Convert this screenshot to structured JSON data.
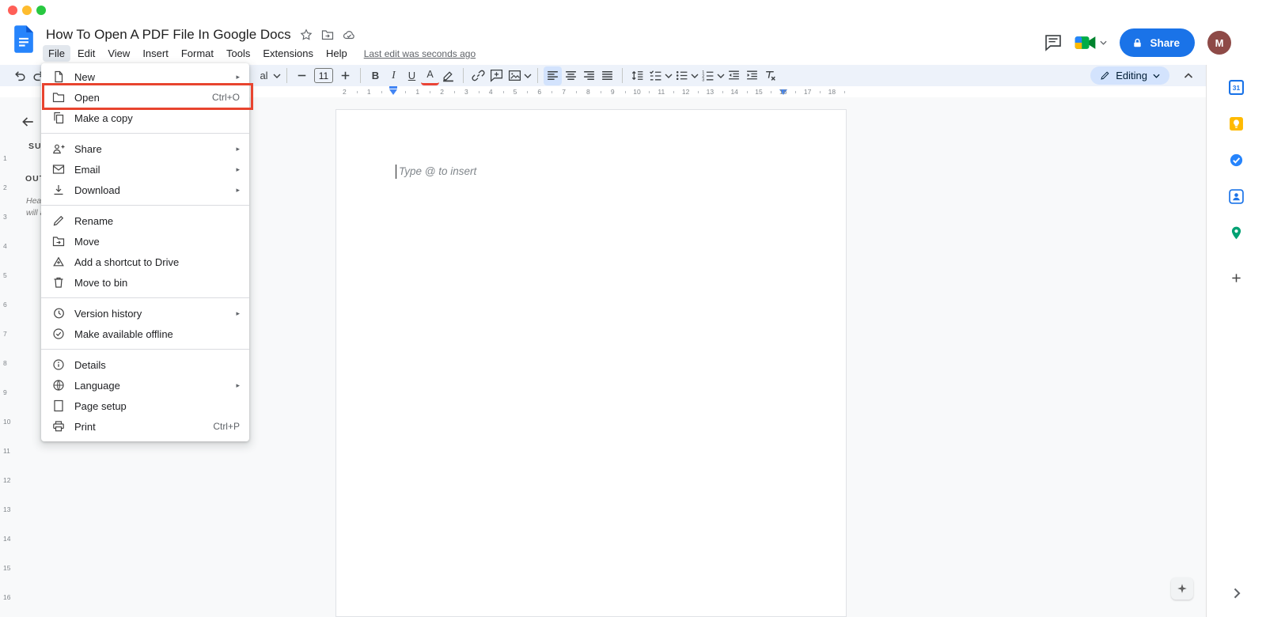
{
  "colors": {
    "accent_blue": "#1a73e8",
    "toolbar_bg": "#edf2fa",
    "editing_chip_bg": "#d3e3fd",
    "highlight_red": "#e8442f",
    "canvas_bg": "#f8f9fa",
    "text_color_underline": "#ea4335",
    "traffic_lights": [
      "#ff5f57",
      "#febc2e",
      "#28c840"
    ]
  },
  "header": {
    "title": "How To Open A PDF File In Google Docs",
    "menu_items": [
      {
        "label": "File",
        "active": true
      },
      {
        "label": "Edit"
      },
      {
        "label": "View"
      },
      {
        "label": "Insert"
      },
      {
        "label": "Format"
      },
      {
        "label": "Tools"
      },
      {
        "label": "Extensions"
      },
      {
        "label": "Help"
      }
    ],
    "last_edit": "Last edit was seconds ago",
    "share_label": "Share",
    "avatar_letter": "M"
  },
  "toolbar": {
    "editing_label": "Editing",
    "items": [
      {
        "name": "undo",
        "icon": "undo-icon"
      },
      {
        "name": "redo",
        "icon": "redo-icon"
      },
      {
        "type": "spacer"
      },
      {
        "name": "font-family-partial",
        "type": "text",
        "text": "al",
        "caret": true
      },
      {
        "type": "sep"
      },
      {
        "name": "decrease-font-size",
        "icon": "minus-icon"
      },
      {
        "name": "font-size",
        "type": "box",
        "text": "11"
      },
      {
        "name": "increase-font-size",
        "icon": "plus-icon"
      },
      {
        "type": "sep"
      },
      {
        "name": "bold",
        "type": "text",
        "text": "B",
        "style": "sb"
      },
      {
        "name": "italic",
        "type": "text",
        "text": "I",
        "style": "si"
      },
      {
        "name": "underline",
        "type": "text",
        "text": "U",
        "style": "su"
      },
      {
        "name": "text-color",
        "type": "text",
        "text": "A",
        "style": "sa"
      },
      {
        "name": "highlight-color",
        "icon": "highlighter-icon"
      },
      {
        "type": "sep"
      },
      {
        "name": "insert-link",
        "icon": "link-icon"
      },
      {
        "name": "add-comment",
        "icon": "comment-add-icon"
      },
      {
        "name": "insert-image",
        "icon": "image-icon",
        "caret": true
      },
      {
        "type": "sep"
      },
      {
        "name": "align-left",
        "icon": "align-left-icon",
        "active": true
      },
      {
        "name": "align-center",
        "icon": "align-center-icon"
      },
      {
        "name": "align-right",
        "icon": "align-right-icon"
      },
      {
        "name": "align-justify",
        "icon": "align-justify-icon"
      },
      {
        "type": "sep"
      },
      {
        "name": "line-spacing",
        "icon": "line-spacing-icon"
      },
      {
        "name": "checklist",
        "icon": "checklist-icon",
        "caret": true
      },
      {
        "name": "bulleted-list",
        "icon": "bullet-list-icon",
        "caret": true
      },
      {
        "name": "numbered-list",
        "icon": "numbered-list-icon",
        "caret": true
      },
      {
        "name": "decrease-indent",
        "icon": "indent-decrease-icon"
      },
      {
        "name": "increase-indent",
        "icon": "indent-increase-icon"
      },
      {
        "name": "clear-formatting",
        "icon": "clear-format-icon"
      }
    ]
  },
  "file_menu": {
    "groups": [
      {
        "items": [
          {
            "label": "New",
            "icon": "new-doc-icon",
            "submenu": true
          },
          {
            "label": "Open",
            "icon": "folder-open-icon",
            "shortcut": "Ctrl+O",
            "highlighted": true
          },
          {
            "label": "Make a copy",
            "icon": "copy-icon"
          }
        ]
      },
      {
        "items": [
          {
            "label": "Share",
            "icon": "share-person-icon",
            "submenu": true
          },
          {
            "label": "Email",
            "icon": "email-icon",
            "submenu": true
          },
          {
            "label": "Download",
            "icon": "download-icon",
            "submenu": true
          }
        ]
      },
      {
        "items": [
          {
            "label": "Rename",
            "icon": "rename-icon"
          },
          {
            "label": "Move",
            "icon": "move-icon"
          },
          {
            "label": "Add a shortcut to Drive",
            "icon": "drive-shortcut-icon"
          },
          {
            "label": "Move to bin",
            "icon": "trash-icon"
          }
        ]
      },
      {
        "items": [
          {
            "label": "Version history",
            "icon": "version-history-icon",
            "submenu": true
          },
          {
            "label": "Make available offline",
            "icon": "offline-icon"
          }
        ]
      },
      {
        "items": [
          {
            "label": "Details",
            "icon": "details-icon"
          },
          {
            "label": "Language",
            "icon": "language-icon",
            "submenu": true
          },
          {
            "label": "Page setup",
            "icon": "page-setup-icon"
          },
          {
            "label": "Print",
            "icon": "print-icon",
            "shortcut": "Ctrl+P"
          }
        ]
      }
    ]
  },
  "ruler": {
    "h_labels_before": [
      "2",
      "1"
    ],
    "h_labels": [
      "1",
      "2",
      "3",
      "4",
      "5",
      "6",
      "7",
      "8",
      "9",
      "10",
      "11",
      "12",
      "13",
      "14",
      "15",
      "16",
      "17",
      "18"
    ],
    "v_labels": [
      "1",
      "2",
      "3",
      "4",
      "5",
      "6",
      "7",
      "8",
      "9",
      "10",
      "11",
      "12",
      "13",
      "14",
      "15",
      "16"
    ]
  },
  "outline_panel": {
    "summary_truncated": "SUM",
    "outline_truncated": "OUTL",
    "hint_lines": [
      "Hea",
      "will a"
    ]
  },
  "document": {
    "placeholder": "Type @ to insert"
  },
  "side_panel": {
    "calendar_day": "31",
    "apps": [
      {
        "name": "calendar",
        "icon": "calendar-icon"
      },
      {
        "name": "keep",
        "icon": "keep-icon"
      },
      {
        "name": "tasks",
        "icon": "tasks-icon"
      },
      {
        "name": "contacts",
        "icon": "contacts-icon"
      },
      {
        "name": "maps",
        "icon": "maps-icon"
      }
    ]
  }
}
